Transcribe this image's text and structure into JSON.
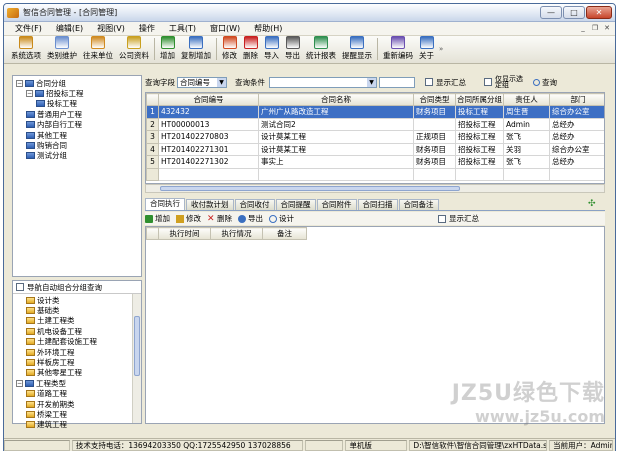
{
  "window": {
    "title": "智信合同管理 - [合同管理]",
    "min": "—",
    "max": "□",
    "close": "✕"
  },
  "menu": [
    "文件(F)",
    "编辑(E)",
    "视图(V)",
    "操作",
    "工具(T)",
    "窗口(W)",
    "帮助(H)"
  ],
  "mdi": {
    "min": "_",
    "restore": "❐",
    "close": "✕"
  },
  "toolbar": [
    {
      "label": "系统选项",
      "icon": "gear-icon",
      "color": "#c98a1a"
    },
    {
      "label": "类别维护",
      "icon": "category-icon",
      "color": "#6a8fcf"
    },
    {
      "label": "往来单位",
      "icon": "contacts-icon",
      "color": "#d08a20"
    },
    {
      "label": "公司资料",
      "icon": "company-icon",
      "color": "#c9a020"
    },
    {
      "label": "增加",
      "icon": "add-icon",
      "color": "#2f8f2f"
    },
    {
      "label": "复制增加",
      "icon": "copy-add-icon",
      "color": "#3a6fc0"
    },
    {
      "label": "修改",
      "icon": "edit-icon",
      "color": "#d04a20"
    },
    {
      "label": "删除",
      "icon": "delete-icon",
      "color": "#c82020"
    },
    {
      "label": "导入",
      "icon": "import-icon",
      "color": "#3a6fc0"
    },
    {
      "label": "导出",
      "icon": "export-icon",
      "color": "#5a5a5a"
    },
    {
      "label": "统计报表",
      "icon": "chart-icon",
      "color": "#2f8f4f"
    },
    {
      "label": "提醒显示",
      "icon": "reminder-icon",
      "color": "#3a6fc0"
    },
    {
      "label": "重新编码",
      "icon": "recode-icon",
      "color": "#6a4fb0"
    },
    {
      "label": "关于",
      "icon": "question-icon",
      "color": "#3a6fc0"
    }
  ],
  "tree": {
    "items": [
      {
        "label": "合同分组",
        "level": 0,
        "expander": "−",
        "folder": "blue"
      },
      {
        "label": "招投标工程",
        "level": 1,
        "expander": "−",
        "folder": "blue"
      },
      {
        "label": "投标工程",
        "level": 2,
        "expander": "",
        "folder": "blue"
      },
      {
        "label": "普通用户工程",
        "level": 1,
        "expander": "",
        "folder": "blue"
      },
      {
        "label": "内部自行工程",
        "level": 1,
        "expander": "",
        "folder": "blue"
      },
      {
        "label": "其他工程",
        "level": 1,
        "expander": "",
        "folder": "blue"
      },
      {
        "label": "购销合同",
        "level": 1,
        "expander": "",
        "folder": "blue"
      },
      {
        "label": "测试分组",
        "level": 1,
        "expander": "",
        "folder": "blue"
      }
    ]
  },
  "lower_panel": {
    "checkbox_label": "导航自动组合分组查询",
    "items": [
      {
        "label": "设计类",
        "level": 1,
        "expander": ""
      },
      {
        "label": "基础类",
        "level": 1,
        "expander": ""
      },
      {
        "label": "土建工程类",
        "level": 1,
        "expander": ""
      },
      {
        "label": "机电设备工程",
        "level": 1,
        "expander": ""
      },
      {
        "label": "土建配套设施工程",
        "level": 1,
        "expander": ""
      },
      {
        "label": "外环境工程",
        "level": 1,
        "expander": ""
      },
      {
        "label": "样板房工程",
        "level": 1,
        "expander": ""
      },
      {
        "label": "其他零星工程",
        "level": 1,
        "expander": ""
      },
      {
        "label": "工程类型",
        "level": 0,
        "expander": "−"
      },
      {
        "label": "道路工程",
        "level": 1,
        "expander": ""
      },
      {
        "label": "开发前期类",
        "level": 1,
        "expander": ""
      },
      {
        "label": "桥梁工程",
        "level": 1,
        "expander": ""
      },
      {
        "label": "建筑工程",
        "level": 1,
        "expander": ""
      }
    ]
  },
  "query": {
    "field_label": "查询字段",
    "field_value": "合同编号",
    "condition_label": "查询条件",
    "show_summary": "显示汇总",
    "show_only_selected": "仅显示选定组",
    "query_button": "查询"
  },
  "grid": {
    "columns": [
      "合同编号",
      "合同名称",
      "合同类型",
      "合同所属分组",
      "责任人",
      "部门"
    ],
    "rows": [
      {
        "n": "1",
        "cells": [
          "432432",
          "广州广从路改造工程",
          "财务项目",
          "投标工程",
          "周生晋",
          "综合办公室"
        ],
        "selected": true
      },
      {
        "n": "2",
        "cells": [
          "HT00000013",
          "测试合同2",
          "",
          "招投标工程",
          "Admin",
          "总经办"
        ],
        "selected": false
      },
      {
        "n": "3",
        "cells": [
          "HT201402270803",
          "设计莫某工程",
          "正规项目",
          "招投标工程",
          "张飞",
          "总经办"
        ],
        "selected": false
      },
      {
        "n": "4",
        "cells": [
          "HT201402271301",
          "设计莫某工程",
          "财务项目",
          "招投标工程",
          "关羽",
          "综合办公室"
        ],
        "selected": false
      },
      {
        "n": "5",
        "cells": [
          "HT201402271302",
          "事实上",
          "财务项目",
          "招投标工程",
          "张飞",
          "总经办"
        ],
        "selected": false
      }
    ]
  },
  "tabs": [
    "合同执行",
    "收付款计划",
    "合同收付",
    "合同提醒",
    "合同附件",
    "合同扫描",
    "合同备注"
  ],
  "detail_toolbar": {
    "add": "增加",
    "edit": "修改",
    "delete": "删除",
    "export": "导出",
    "design": "设计",
    "show_summary": "显示汇总"
  },
  "detail_columns": [
    "执行时间",
    "执行情况",
    "备注"
  ],
  "status": {
    "support": "技术支持电话：13694203350 QQ:1725542950 137028856",
    "mode": "单机版",
    "path": "D:\\智信软件\\智信合同管理\\zxHTData.sys",
    "user": "当前用户：Admin"
  },
  "watermark": {
    "line1": "JZ5U绿色下载",
    "line2": "www.jz5u.com"
  }
}
